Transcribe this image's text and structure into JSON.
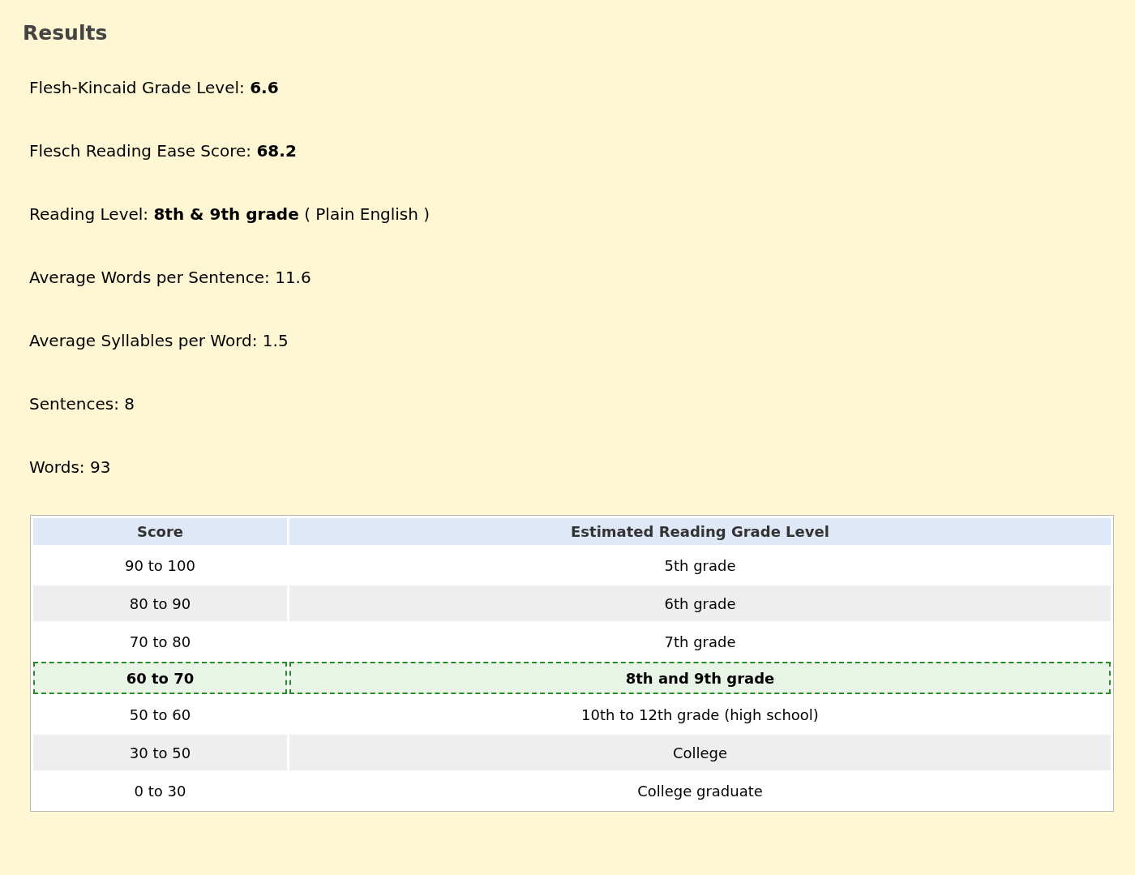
{
  "title": "Results",
  "stats": [
    {
      "label": "Flesh-Kincaid Grade Level:",
      "value": "6.6",
      "emphasized": true
    },
    {
      "label": "Flesch Reading Ease Score:",
      "value": "68.2",
      "emphasized": true
    },
    {
      "label": "Reading Level:",
      "value": "8th & 9th grade",
      "emphasized": true,
      "note": "( Plain English )"
    },
    {
      "label": "Average Words per Sentence:",
      "value": "11.6",
      "emphasized": false
    },
    {
      "label": "Average Syllables per Word:",
      "value": "1.5",
      "emphasized": false
    },
    {
      "label": "Sentences:",
      "value": "8",
      "emphasized": false
    },
    {
      "label": "Words:",
      "value": "93",
      "emphasized": false
    }
  ],
  "table": {
    "columns": [
      "Score",
      "Estimated Reading Grade Level"
    ],
    "rows": [
      {
        "score": "90 to 100",
        "level": "5th grade",
        "selected": false
      },
      {
        "score": "80 to 90",
        "level": "6th grade",
        "selected": false
      },
      {
        "score": "70 to 80",
        "level": "7th grade",
        "selected": false
      },
      {
        "score": "60 to 70",
        "level": "8th and 9th grade",
        "selected": true
      },
      {
        "score": "50 to 60",
        "level": "10th to 12th grade (high school)",
        "selected": false
      },
      {
        "score": "30 to 50",
        "level": "College",
        "selected": false
      },
      {
        "score": "0 to 30",
        "level": "College graduate",
        "selected": false
      }
    ]
  }
}
